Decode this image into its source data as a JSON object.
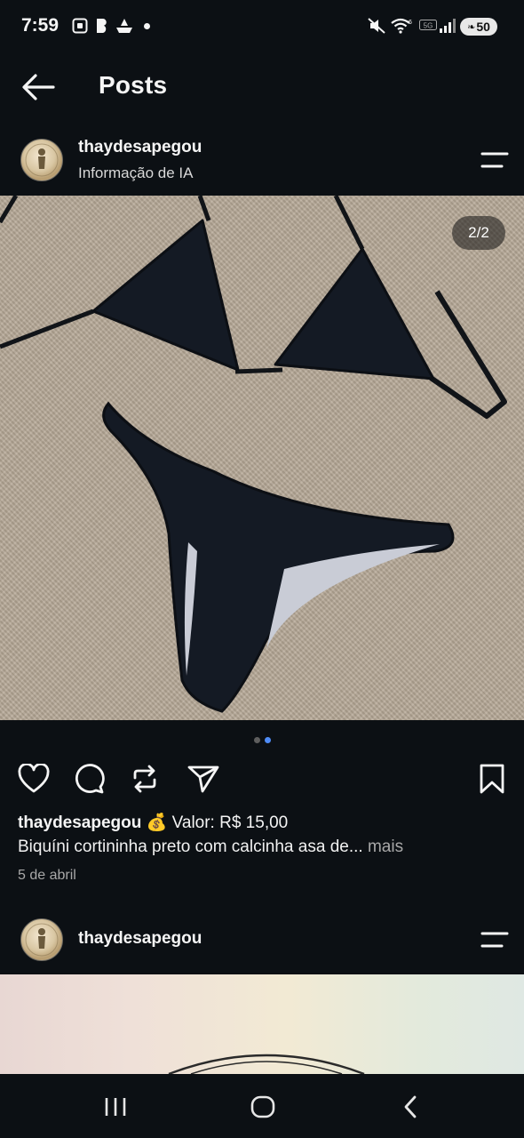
{
  "status_bar": {
    "time": "7:59",
    "battery": "50",
    "network": "5G"
  },
  "header": {
    "title": "Posts"
  },
  "post": {
    "username": "thaydesapegou",
    "ai_info": "Informação de IA",
    "image_counter": "2/2",
    "caption_username": "thaydesapegou",
    "caption_emoji": "💰",
    "caption_price": "Valor: R$ 15,00",
    "description": "Biquíni cortininha preto com calcinha asa de...",
    "more_label": "mais",
    "date": "5 de abril"
  },
  "next_post": {
    "username": "thaydesapegou"
  },
  "colors": {
    "background": "#0c1014",
    "active_dot": "#4f8cf7",
    "inactive_dot": "#5e5e5e"
  }
}
